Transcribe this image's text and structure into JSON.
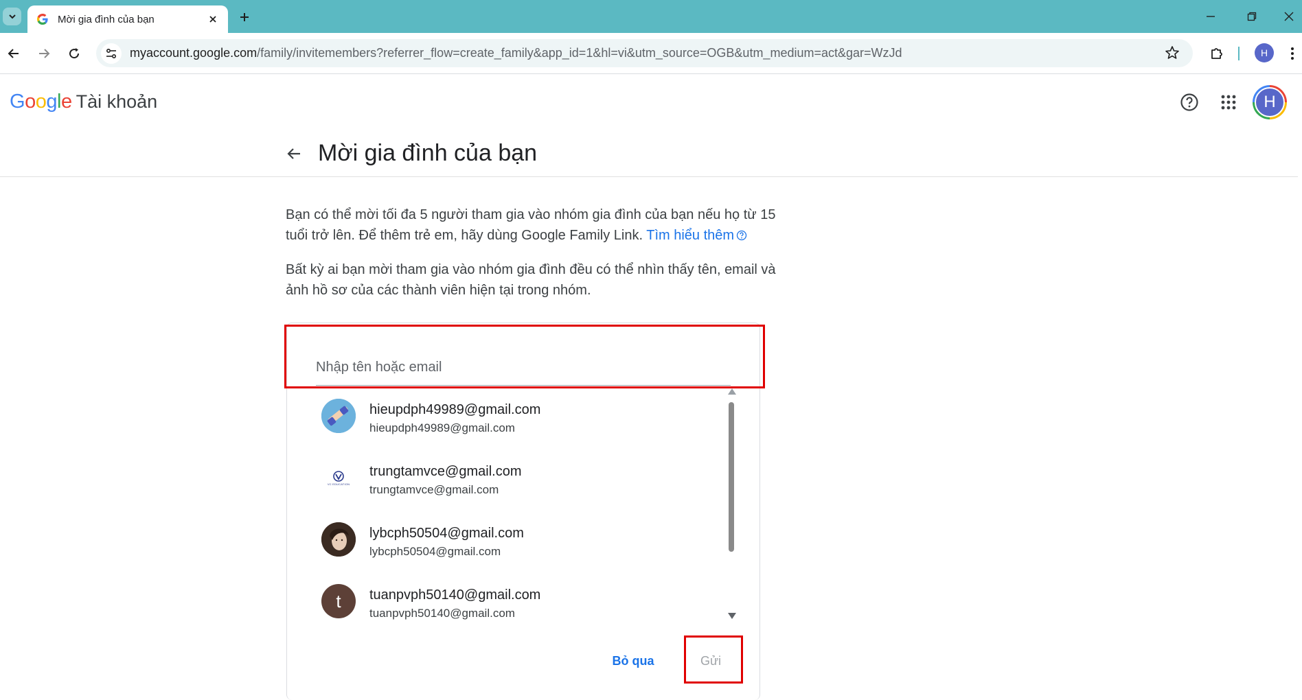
{
  "browser": {
    "tab_title": "Mời gia đình của bạn",
    "url_host": "myaccount.google.com",
    "url_path": "/family/invitemembers?referrer_flow=create_family&app_id=1&hl=vi&utm_source=OGB&utm_medium=act&gar=WzJd",
    "profile_initial": "H",
    "chrome_color": "#5bb9c2"
  },
  "header": {
    "logo_letters": [
      "G",
      "o",
      "o",
      "g",
      "l",
      "e"
    ],
    "logo_colors": [
      "#4285f4",
      "#ea4335",
      "#fbbc05",
      "#4285f4",
      "#34a853",
      "#ea4335"
    ],
    "product": "Tài khoản",
    "avatar_initial": "H"
  },
  "page": {
    "title": "Mời gia đình của bạn",
    "intro_text": "Bạn có thể mời tối đa 5 người tham gia vào nhóm gia đình của bạn nếu họ từ 15 tuổi trở lên. Để thêm trẻ em, hãy dùng Google Family Link.",
    "learn_more": "Tìm hiểu thêm",
    "visibility_text": "Bất kỳ ai bạn mời tham gia vào nhóm gia đình đều có thể nhìn thấy tên, email và ảnh hồ sơ của các thành viên hiện tại trong nhóm."
  },
  "invite": {
    "placeholder": "Nhập tên hoặc email",
    "suggestions": [
      {
        "name": "hieupdph49989@gmail.com",
        "email": "hieupdph49989@gmail.com"
      },
      {
        "name": "trungtamvce@gmail.com",
        "email": "trungtamvce@gmail.com",
        "avatar_caption": "VC EDUCATION"
      },
      {
        "name": "lybcph50504@gmail.com",
        "email": "lybcph50504@gmail.com"
      },
      {
        "name": "tuanpvph50140@gmail.com",
        "email": "tuanpvph50140@gmail.com",
        "avatar_initial": "t"
      }
    ],
    "skip_label": "Bỏ qua",
    "send_label": "Gửi"
  }
}
